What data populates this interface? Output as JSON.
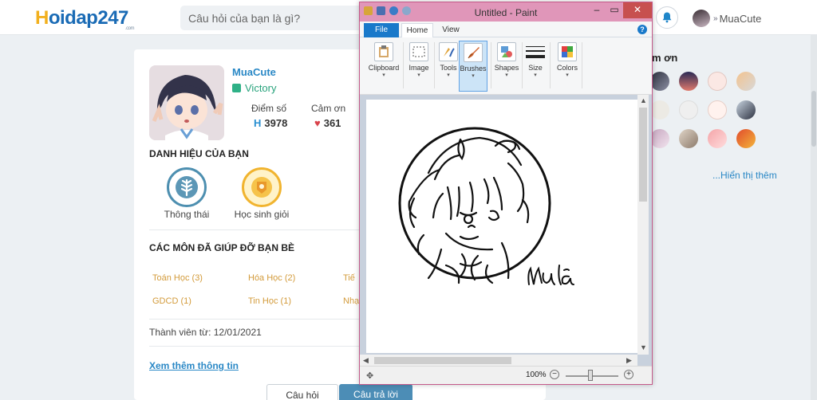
{
  "header": {
    "logo": "Hoidap247",
    "logo_sub": ".com",
    "search_placeholder": "Câu hỏi của bạn là gì?",
    "username": "MuaCute"
  },
  "profile": {
    "name": "MuaCute",
    "rank": "Victory",
    "score_label": "Điểm số",
    "score_value": "3978",
    "thanks_label": "Cảm ơn",
    "thanks_value": "361",
    "titles_heading": "DANH HIỆU CỦA BẠN",
    "badges": [
      {
        "label": "Thông thái",
        "icon": "wheat-icon",
        "color": "#4d8fb0"
      },
      {
        "label": "Học sinh giỏi",
        "icon": "medal-icon",
        "color": "#f1b42f"
      }
    ],
    "subjects_heading": "CÁC MÔN ĐÃ GIÚP ĐỠ BẠN BÈ",
    "subjects": [
      "Toán Học (3)",
      "Hóa Học (2)",
      "Tiế",
      "GDCD (1)",
      "Tin Học (1)",
      "Nhạ"
    ],
    "member_since": "Thành viên từ: 12/01/2021",
    "more_info": "Xem thêm thông tin",
    "btn_question": "Câu hỏi",
    "btn_answer": "Câu trả lời"
  },
  "thanks_panel": {
    "title": "m ơn",
    "show_more": "...Hiển thị thêm"
  },
  "paint": {
    "title": "Untitled - Paint",
    "tabs": [
      "File",
      "Home",
      "View"
    ],
    "groups": [
      "Clipboard",
      "Image",
      "Tools",
      "Brushes",
      "Shapes",
      "Size",
      "Colors"
    ],
    "zoom": "100%",
    "signature": "Mửa"
  }
}
